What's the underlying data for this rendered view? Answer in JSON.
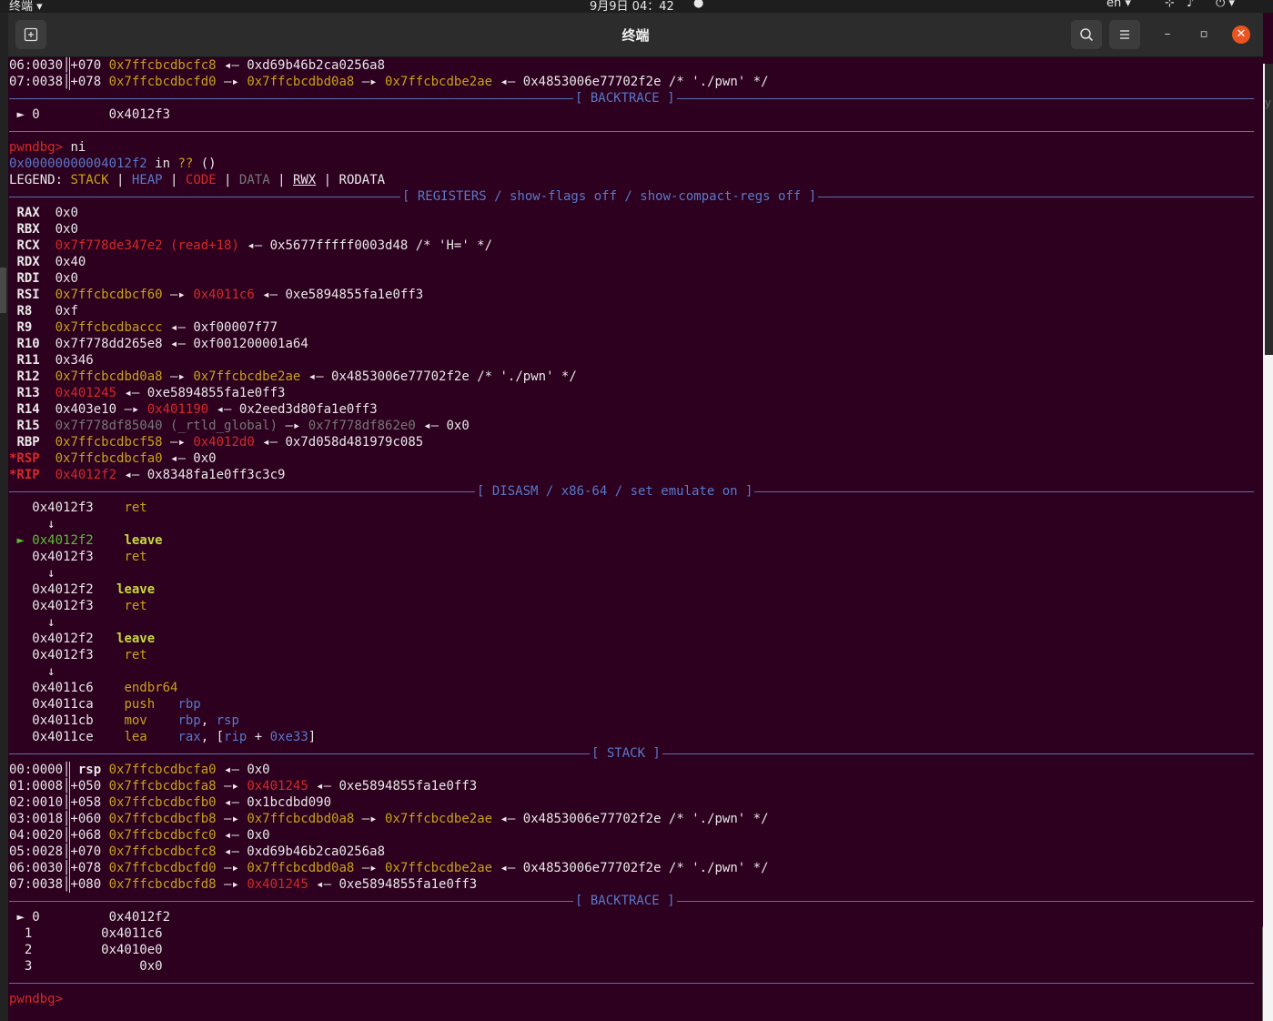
{
  "topbar": {
    "app_menu": "终端 ▾",
    "clock": "9月9日 04：42",
    "lang": "en ▾"
  },
  "window": {
    "title": "终端",
    "buttons": {
      "new_tab": "new-tab-icon",
      "search": "search-icon",
      "menu": "hamburger-menu-icon",
      "minimize": "–",
      "maximize": "▫",
      "close": "✕"
    }
  },
  "colors": {
    "background": "#2c001e",
    "address_yellow": "#c8a21a",
    "code_red": "#d42a2a",
    "label_blue": "#5a79c8",
    "current_green": "#5bbd32"
  },
  "terminal": {
    "stack_top": [
      "06:0030│+070 ",
      "0x7ffcbcdbcfc8",
      " ◂— 0xd69b46b2ca0256a8",
      "07:0038│+078 ",
      "0x7ffcbcdbcfd0",
      " —▸ ",
      "0x7ffcbcdbd0a8",
      " —▸ ",
      "0x7ffcbcdbe2ae",
      " ◂— 0x4853006e77702f2e /* './pwn' */"
    ],
    "backtrace_label": "[ BACKTRACE ]",
    "backtrace_top": [
      "►",
      " 0         0x4012f3"
    ],
    "prompt": "pwndbg>",
    "command": " ni",
    "location": [
      "0x00000000004012f2",
      " in ",
      "??",
      " ()"
    ],
    "legend": [
      "LEGEND: ",
      "STACK",
      " | ",
      "HEAP",
      " | ",
      "CODE",
      " | ",
      "DATA",
      " | ",
      "RWX",
      " | RODATA"
    ],
    "registers_label": "[ REGISTERS / show-flags off / show-compact-regs off ]",
    "registers": [
      [
        "RAX",
        "0x0"
      ],
      [
        "RBX",
        "0x0"
      ],
      [
        "RCX",
        "0x7f778de347e2 (read+18)",
        " ◂— 0x5677fffff0003d48 /* 'H=' */"
      ],
      [
        "RDX",
        "0x40"
      ],
      [
        "RDI",
        "0x0"
      ],
      [
        "RSI",
        "0x7ffcbcdbcf60",
        " —▸ ",
        "0x4011c6",
        " ◂— 0xe5894855fa1e0ff3"
      ],
      [
        "R8",
        "0xf"
      ],
      [
        "R9",
        "0x7ffcbcdbaccc",
        " ◂— 0xf00007f77"
      ],
      [
        "R10",
        "0x7f778dd265e8",
        " ◂— 0xf001200001a64"
      ],
      [
        "R11",
        "0x346"
      ],
      [
        "R12",
        "0x7ffcbcdbd0a8",
        " —▸ ",
        "0x7ffcbcdbe2ae",
        " ◂— 0x4853006e77702f2e /* './pwn' */"
      ],
      [
        "R13",
        "0x401245",
        " ◂— 0xe5894855fa1e0ff3"
      ],
      [
        "R14",
        "0x403e10",
        " —▸ ",
        "0x401190",
        " ◂— 0x2eed3d80fa1e0ff3"
      ],
      [
        "R15",
        "0x7f778df85040 (_rtld_global)",
        " —▸ ",
        "0x7f778df862e0",
        " ◂— 0x0"
      ],
      [
        "RBP",
        "0x7ffcbcdbcf58",
        " —▸ ",
        "0x4012d0",
        " ◂— 0x7d058d481979c085"
      ],
      [
        "*RSP",
        "0x7ffcbcdbcfa0",
        " ◂— 0x0"
      ],
      [
        "*RIP",
        "0x4012f2",
        " ◂— 0x8348fa1e0ff3c3c9"
      ]
    ],
    "disasm_label": "[ DISASM / x86-64 / set emulate on ]",
    "disasm": [
      [
        "   0x4012f3    ",
        "ret"
      ],
      [
        "     ↓"
      ],
      [
        "►",
        " 0x4012f2",
        "    ",
        "leave"
      ],
      [
        "   0x4012f3    ",
        "ret"
      ],
      [
        "     ↓"
      ],
      [
        "   0x4012f2   ",
        "leave"
      ],
      [
        "   0x4012f3    ",
        "ret"
      ],
      [
        "     ↓"
      ],
      [
        "   0x4012f2   ",
        "leave"
      ],
      [
        "   0x4012f3    ",
        "ret"
      ],
      [
        "     ↓"
      ],
      [
        "   0x4011c6    ",
        "endbr64"
      ],
      [
        "   0x4011ca    ",
        "push   ",
        "rbp"
      ],
      [
        "   0x4011cb    ",
        "mov    ",
        "rbp",
        ", ",
        "rsp"
      ],
      [
        "   0x4011ce    ",
        "lea    ",
        "rax",
        ", [",
        "rip",
        " + ",
        "0xe33",
        "]"
      ]
    ],
    "stack_label": "[ STACK ]",
    "stack": [
      [
        "00:0000│ ",
        "rsp",
        " ",
        "0x7ffcbcdbcfa0",
        " ◂— 0x0"
      ],
      [
        "01:0008│+050 ",
        "0x7ffcbcdbcfa8",
        " —▸ ",
        "0x401245",
        " ◂— 0xe5894855fa1e0ff3"
      ],
      [
        "02:0010│+058 ",
        "0x7ffcbcdbcfb0",
        " ◂— 0x1bcdbd090"
      ],
      [
        "03:0018│+060 ",
        "0x7ffcbcdbcfb8",
        " —▸ ",
        "0x7ffcbcdbd0a8",
        " —▸ ",
        "0x7ffcbcdbe2ae",
        " ◂— 0x4853006e77702f2e /* './pwn' */"
      ],
      [
        "04:0020│+068 ",
        "0x7ffcbcdbcfc0",
        " ◂— 0x0"
      ],
      [
        "05:0028│+070 ",
        "0x7ffcbcdbcfc8",
        " ◂— 0xd69b46b2ca0256a8"
      ],
      [
        "06:0030│+078 ",
        "0x7ffcbcdbcfd0",
        " —▸ ",
        "0x7ffcbcdbd0a8",
        " —▸ ",
        "0x7ffcbcdbe2ae",
        " ◂— 0x4853006e77702f2e /* './pwn' */"
      ],
      [
        "07:0038│+080 ",
        "0x7ffcbcdbcfd8",
        " —▸ ",
        "0x401245",
        " ◂— 0xe5894855fa1e0ff3"
      ]
    ],
    "backtrace": [
      [
        "►",
        " 0         0x4012f2"
      ],
      [
        "",
        "  1         0x4011c6"
      ],
      [
        "",
        "  2         0x4010e0"
      ],
      [
        "",
        "  3              0x0"
      ]
    ],
    "final_prompt": "pwndbg>"
  }
}
